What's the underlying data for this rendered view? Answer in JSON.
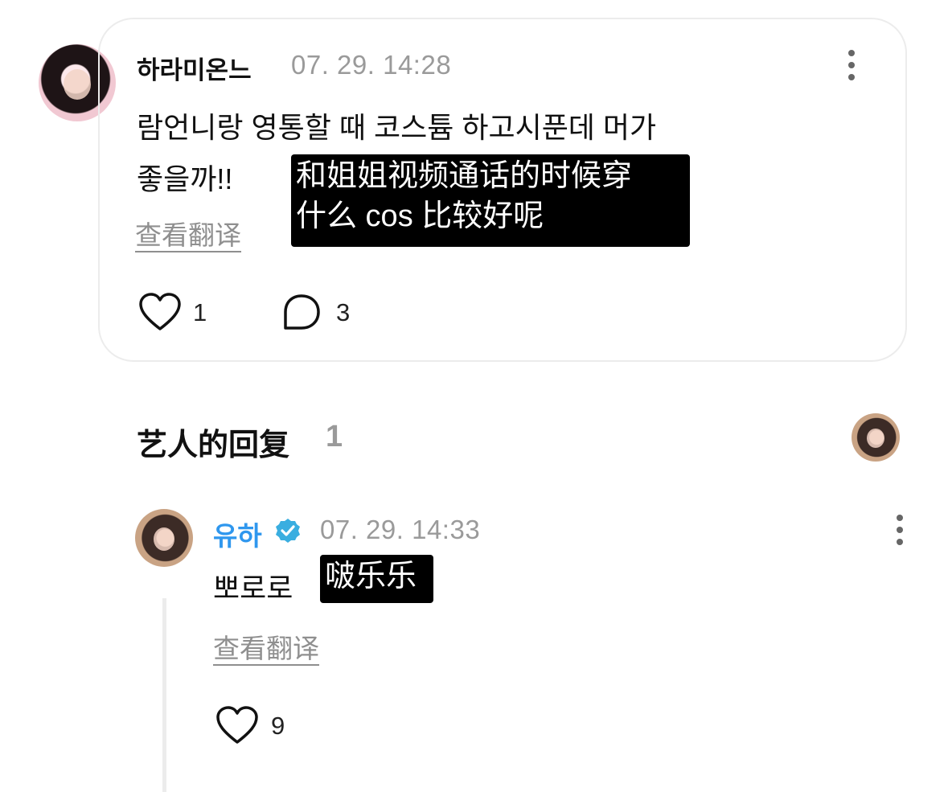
{
  "comment": {
    "username": "하라미온느",
    "timestamp": "07. 29. 14:28",
    "text_line1": "람언니랑 영통할 때 코스튬 하고시푼데 머가",
    "text_line2": "좋을까!!",
    "translation_overlay_line1": "和姐姐视频通话的时候穿",
    "translation_overlay_line2": "什么 cos 比较好呢",
    "see_translation": "查看翻译",
    "like_count": "1",
    "reply_count": "3"
  },
  "artist_replies": {
    "title": "艺人的回复",
    "count": "1"
  },
  "reply": {
    "username": "유하",
    "timestamp": "07. 29. 14:33",
    "text": "뽀로로",
    "translation_overlay": "啵乐乐",
    "see_translation": "查看翻译",
    "like_count": "9"
  },
  "colors": {
    "artist_name": "#2f97ee",
    "verified_badge": "#3aaee0",
    "timestamp": "#9a9a9a",
    "card_border": "#ececec"
  }
}
